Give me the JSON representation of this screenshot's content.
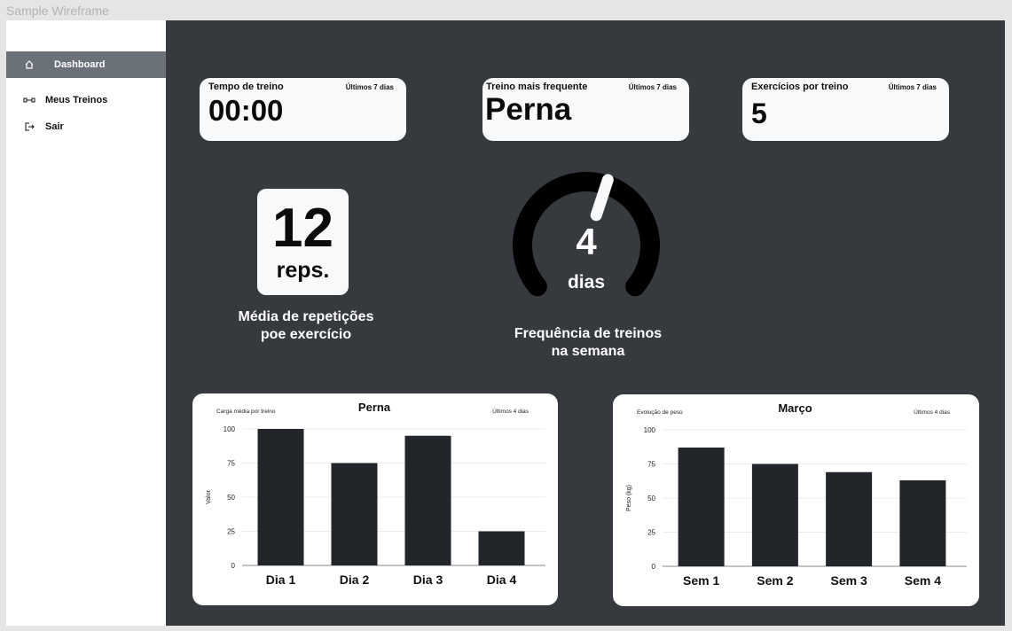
{
  "frame_label": "Sample Wireframe",
  "sidebar": {
    "items": [
      {
        "label": "Dashboard",
        "icon": "home-icon",
        "active": true
      },
      {
        "label": "Meus Treinos",
        "icon": "dumbbell-icon",
        "active": false
      },
      {
        "label": "Sair",
        "icon": "logout-icon",
        "active": false
      }
    ]
  },
  "cards": {
    "tempo": {
      "title": "Tempo de treino",
      "period": "Últimos 7 dias",
      "value": "00:00"
    },
    "frequente": {
      "title": "Treino mais frequente",
      "period": "Últimos 7 dias",
      "value": "Perna"
    },
    "exercicios": {
      "title": "Exercícios por treino",
      "period": "Últimos 7 dias",
      "value": "5"
    }
  },
  "reps": {
    "value": "12",
    "unit": "reps.",
    "caption_line1": "Média de repetições",
    "caption_line2": "poe exercício"
  },
  "gauge": {
    "value": "4",
    "unit": "dias",
    "caption_line1": "Frequência de treinos",
    "caption_line2": "na semana",
    "fraction": 0.57
  },
  "colors": {
    "bar": "#222529",
    "background": "#36393e",
    "card": "#f8f9fa",
    "active_nav": "#6b7178"
  },
  "chart_data": [
    {
      "type": "bar",
      "title": "Perna",
      "subtitle": "Carga média por treino",
      "period": "Últimos 4 dias",
      "xlabel": "",
      "ylabel": "Valor",
      "categories": [
        "Dia 1",
        "Dia 2",
        "Dia 3",
        "Dia 4"
      ],
      "values": [
        100,
        75,
        95,
        25
      ],
      "ylim": [
        0,
        100
      ],
      "yticks": [
        "0",
        "25",
        "50",
        "75",
        "100"
      ],
      "grid": true
    },
    {
      "type": "bar",
      "title": "Março",
      "subtitle": "Evolução de peso",
      "period": "Últimos 4 dias",
      "xlabel": "",
      "ylabel": "Peso (kg)",
      "categories": [
        "Sem 1",
        "Sem 2",
        "Sem 3",
        "Sem 4"
      ],
      "values": [
        87,
        75,
        69,
        63
      ],
      "ylim": [
        0,
        100
      ],
      "yticks": [
        "0",
        "25",
        "50",
        "75",
        "100"
      ],
      "grid": true
    }
  ]
}
